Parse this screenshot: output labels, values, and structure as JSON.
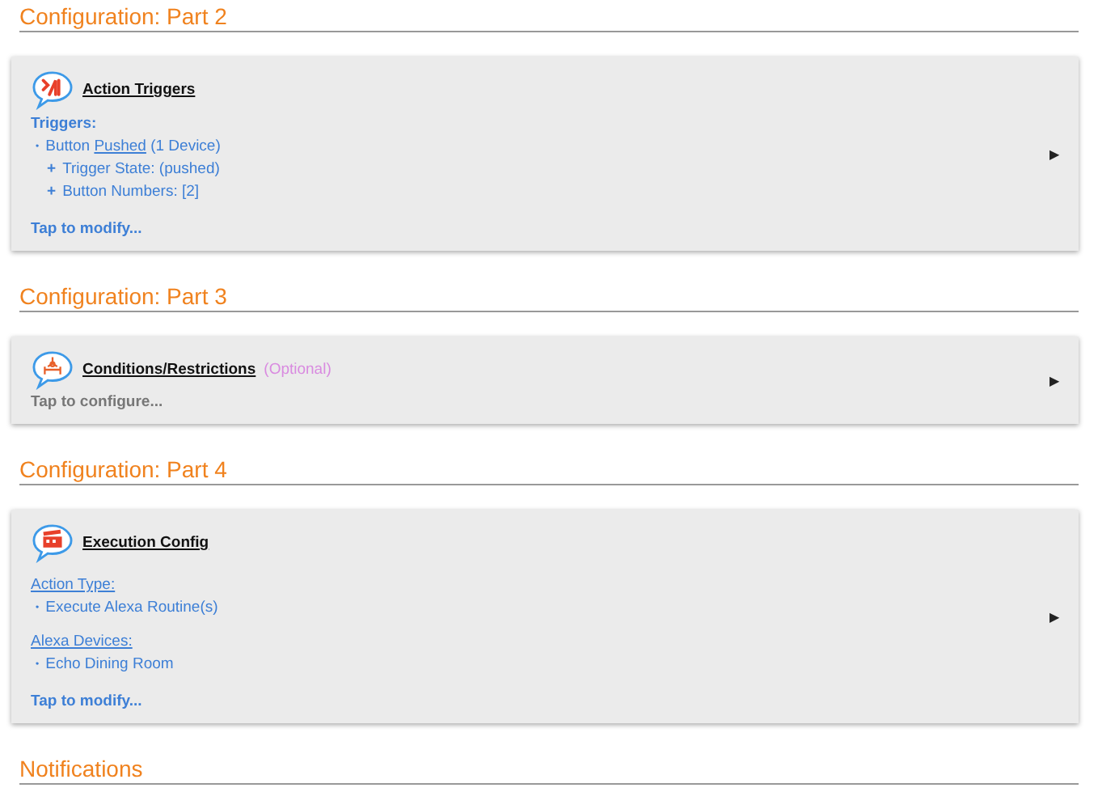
{
  "sections": [
    {
      "heading": "Configuration: Part 2",
      "card": {
        "title": "Action Triggers",
        "lines": [
          {
            "kind": "label",
            "parts": [
              {
                "text": "Triggers:",
                "underline": false
              }
            ]
          },
          {
            "kind": "bullet",
            "marker": "•",
            "parts": [
              {
                "text": "Button ",
                "underline": false
              },
              {
                "text": "Pushed",
                "underline": true
              },
              {
                "text": " (1 Device)",
                "underline": false
              }
            ]
          },
          {
            "kind": "sub",
            "marker": "+",
            "parts": [
              {
                "text": "Trigger State: (pushed)",
                "underline": false
              }
            ]
          },
          {
            "kind": "sub",
            "marker": "+",
            "parts": [
              {
                "text": "Button Numbers: [2]",
                "underline": false
              }
            ]
          }
        ],
        "footer": {
          "text": "Tap to modify...",
          "muted": false
        },
        "arrow": "▶"
      }
    },
    {
      "heading": "Configuration: Part 3",
      "card": {
        "title": "Conditions/Restrictions",
        "note": "(Optional)",
        "footer": {
          "text": "Tap to configure...",
          "muted": true
        },
        "arrow": "▶"
      }
    },
    {
      "heading": "Configuration: Part 4",
      "card": {
        "title": "Execution Config",
        "lines": [
          {
            "kind": "group",
            "parts": [
              {
                "text": "Action Type:",
                "underline": true
              }
            ]
          },
          {
            "kind": "bullet",
            "marker": "•",
            "parts": [
              {
                "text": "Execute Alexa Routine(s)",
                "underline": false
              }
            ]
          },
          {
            "kind": "group",
            "parts": [
              {
                "text": "Alexa Devices:",
                "underline": true
              }
            ]
          },
          {
            "kind": "bullet",
            "marker": "•",
            "parts": [
              {
                "text": "Echo Dining Room",
                "underline": false
              }
            ]
          }
        ],
        "footer": {
          "text": "Tap to modify...",
          "muted": false
        },
        "arrow": "▶"
      }
    },
    {
      "heading": "Notifications"
    }
  ]
}
